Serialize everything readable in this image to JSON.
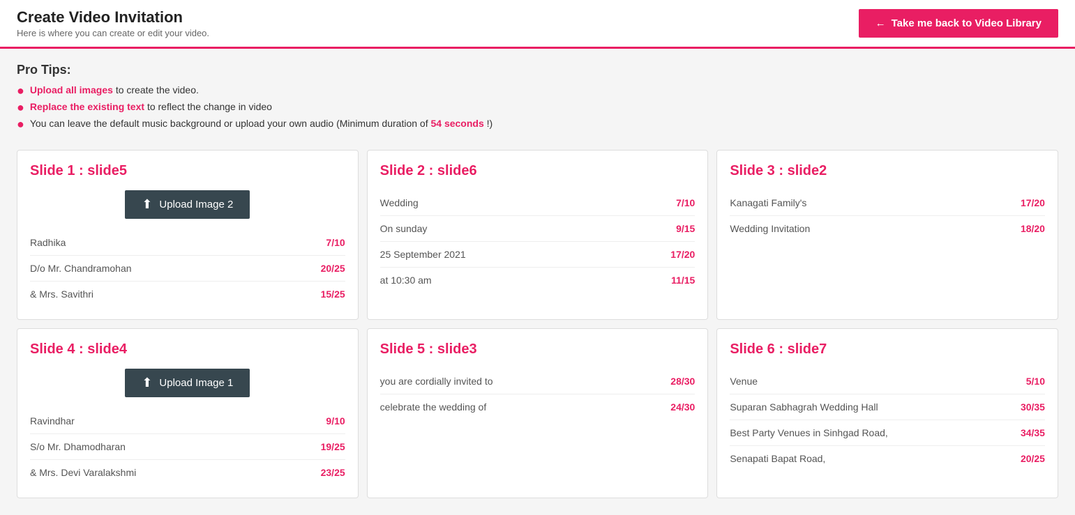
{
  "header": {
    "title": "Create Video Invitation",
    "subtitle": "Here is where you can create or edit your video.",
    "back_button_label": "Take me back to Video Library",
    "back_arrow": "←"
  },
  "pro_tips": {
    "title": "Pro Tips:",
    "tips": [
      {
        "highlight": "Upload all images",
        "rest": " to create the video."
      },
      {
        "highlight": "Replace the existing text",
        "rest": " to reflect the change in video"
      },
      {
        "prefix": "You can leave the default music background or upload your own audio (Minimum duration of ",
        "highlight": "54 seconds",
        "suffix": "!)"
      }
    ]
  },
  "slides": [
    {
      "id": "slide1",
      "title": "Slide 1 : slide5",
      "upload_button": "Upload Image 2",
      "fields": [
        {
          "label": "Radhika",
          "count": "7/10"
        },
        {
          "label": "D/o Mr. Chandramohan",
          "count": "20/25"
        },
        {
          "label": "& Mrs. Savithri",
          "count": "15/25"
        }
      ]
    },
    {
      "id": "slide2",
      "title": "Slide 2 : slide6",
      "fields": [
        {
          "label": "Wedding",
          "count": "7/10"
        },
        {
          "label": "On sunday",
          "count": "9/15"
        },
        {
          "label": "25 September 2021",
          "count": "17/20"
        },
        {
          "label": "at 10:30 am",
          "count": "11/15"
        }
      ]
    },
    {
      "id": "slide3",
      "title": "Slide 3 : slide2",
      "fields": [
        {
          "label": "Kanagati Family's",
          "count": "17/20"
        },
        {
          "label": "Wedding Invitation",
          "count": "18/20"
        }
      ]
    },
    {
      "id": "slide4",
      "title": "Slide 4 : slide4",
      "upload_button": "Upload Image 1",
      "fields": [
        {
          "label": "Ravindhar",
          "count": "9/10"
        },
        {
          "label": "S/o Mr. Dhamodharan",
          "count": "19/25"
        },
        {
          "label": "& Mrs. Devi Varalakshmi",
          "count": "23/25"
        }
      ]
    },
    {
      "id": "slide5",
      "title": "Slide 5 : slide3",
      "fields": [
        {
          "label": "you are cordially invited to",
          "count": "28/30"
        },
        {
          "label": "celebrate the wedding of",
          "count": "24/30"
        }
      ]
    },
    {
      "id": "slide6",
      "title": "Slide 6 : slide7",
      "fields": [
        {
          "label": "Venue",
          "count": "5/10"
        },
        {
          "label": "Suparan Sabhagrah Wedding Hall",
          "count": "30/35"
        },
        {
          "label": "Best Party Venues in Sinhgad Road,",
          "count": "34/35"
        },
        {
          "label": "Senapati Bapat Road,",
          "count": "20/25"
        }
      ]
    }
  ]
}
